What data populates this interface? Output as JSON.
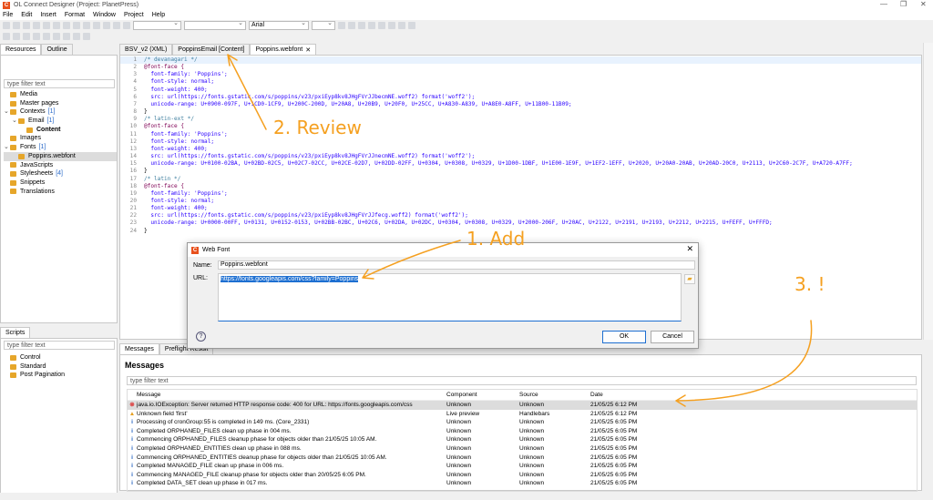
{
  "window": {
    "title": "OL Connect Designer (Project: PlanetPress)",
    "min": "—",
    "max": "❐",
    "close": "✕"
  },
  "menu": [
    "File",
    "Edit",
    "Insert",
    "Format",
    "Window",
    "Project",
    "Help"
  ],
  "toolbar": {
    "font_combo": "Arial"
  },
  "left_panel": {
    "tabs": [
      "Resources",
      "Outline"
    ],
    "filter_placeholder": "type filter text",
    "tree": [
      {
        "label": "Media",
        "level": 0
      },
      {
        "label": "Master pages",
        "level": 0
      },
      {
        "label": "Contexts",
        "count": "[1]",
        "level": 0,
        "expanded": true
      },
      {
        "label": "Email",
        "count": "[1]",
        "level": 1,
        "expanded": true
      },
      {
        "label": "Content",
        "level": 2,
        "bold": true
      },
      {
        "label": "Images",
        "level": 0
      },
      {
        "label": "Fonts",
        "count": "[1]",
        "level": 0,
        "expanded": true
      },
      {
        "label": "Poppins.webfont",
        "level": 1,
        "selected": true
      },
      {
        "label": "JavaScripts",
        "level": 0
      },
      {
        "label": "Stylesheets",
        "count": "[4]",
        "level": 0
      },
      {
        "label": "Snippets",
        "level": 0
      },
      {
        "label": "Translations",
        "level": 0
      }
    ]
  },
  "scripts_panel": {
    "tab": "Scripts",
    "filter_placeholder": "type filter text",
    "items": [
      "Control",
      "Standard",
      "Post Pagination"
    ]
  },
  "editor": {
    "tabs": [
      "BSV_v2 (XML)",
      "PoppinsEmail [Content]",
      "Poppins.webfont"
    ],
    "active_tab": 2,
    "lines": [
      "/* devanagari */",
      "@font-face {",
      "  font-family: 'Poppins';",
      "  font-style: normal;",
      "  font-weight: 400;",
      "  src: url(https://fonts.gstatic.com/s/poppins/v23/pxiEyp8kv8JHgFVrJJbecmNE.woff2) format('woff2');",
      "  unicode-range: U+0900-097F, U+1CD0-1CF9, U+200C-200D, U+20A8, U+20B9, U+20F0, U+25CC, U+A830-A839, U+A8E0-A8FF, U+11B00-11B09;",
      "}",
      "/* latin-ext */",
      "@font-face {",
      "  font-family: 'Poppins';",
      "  font-style: normal;",
      "  font-weight: 400;",
      "  src: url(https://fonts.gstatic.com/s/poppins/v23/pxiEyp8kv8JHgFVrJJnecmNE.woff2) format('woff2');",
      "  unicode-range: U+0100-02BA, U+02BD-02C5, U+02C7-02CC, U+02CE-02D7, U+02DD-02FF, U+0304, U+0308, U+0329, U+1D00-1DBF, U+1E00-1E9F, U+1EF2-1EFF, U+2020, U+20A0-20AB, U+20AD-20C0, U+2113, U+2C60-2C7F, U+A720-A7FF;",
      "}",
      "/* latin */",
      "@font-face {",
      "  font-family: 'Poppins';",
      "  font-style: normal;",
      "  font-weight: 400;",
      "  src: url(https://fonts.gstatic.com/s/poppins/v23/pxiEyp8kv8JHgFVrJJfecg.woff2) format('woff2');",
      "  unicode-range: U+0000-00FF, U+0131, U+0152-0153, U+02BB-02BC, U+02C6, U+02DA, U+02DC, U+0304, U+0308, U+0329, U+2000-206F, U+20AC, U+2122, U+2191, U+2193, U+2212, U+2215, U+FEFF, U+FFFD;",
      "}"
    ]
  },
  "dialog": {
    "title": "Web Font",
    "name_label": "Name:",
    "name_value": "Poppins.webfont",
    "url_label": "URL:",
    "url_value": "https://fonts.googleapis.com/css?family=Poppins",
    "ok": "OK",
    "cancel": "Cancel",
    "help": "?"
  },
  "messages": {
    "tabs": [
      "Messages",
      "Preflight Result"
    ],
    "title": "Messages",
    "filter_placeholder": "type filter text",
    "columns": [
      "Message",
      "Component",
      "Source",
      "Date"
    ],
    "rows": [
      {
        "type": "error",
        "message": "java.io.IOException: Server returned HTTP response code: 400 for URL: https://fonts.googleapis.com/css",
        "component": "Unknown",
        "source": "Unknown",
        "date": "21/05/25 6:12 PM"
      },
      {
        "type": "warning",
        "message": "Unknown field 'first'",
        "component": "Live preview",
        "source": "Handlebars",
        "date": "21/05/25 6:12 PM"
      },
      {
        "type": "info",
        "message": "Processing of cronGroup:55 is completed in 149 ms. (Core_2331)",
        "component": "Unknown",
        "source": "Unknown",
        "date": "21/05/25 6:05 PM"
      },
      {
        "type": "info",
        "message": "Completed ORPHANED_FILES clean up phase in 004 ms.",
        "component": "Unknown",
        "source": "Unknown",
        "date": "21/05/25 6:05 PM"
      },
      {
        "type": "info",
        "message": "Commencing ORPHANED_FILES cleanup phase for objects older than 21/05/25 10:05 AM.",
        "component": "Unknown",
        "source": "Unknown",
        "date": "21/05/25 6:05 PM"
      },
      {
        "type": "info",
        "message": "Completed ORPHANED_ENTITIES clean up phase in 088 ms.",
        "component": "Unknown",
        "source": "Unknown",
        "date": "21/05/25 6:05 PM"
      },
      {
        "type": "info",
        "message": "Commencing ORPHANED_ENTITIES cleanup phase for objects older than 21/05/25 10:05 AM.",
        "component": "Unknown",
        "source": "Unknown",
        "date": "21/05/25 6:05 PM"
      },
      {
        "type": "info",
        "message": "Completed MANAGED_FILE clean up phase in 006 ms.",
        "component": "Unknown",
        "source": "Unknown",
        "date": "21/05/25 6:05 PM"
      },
      {
        "type": "info",
        "message": "Commencing MANAGED_FILE cleanup phase for objects older than 20/05/25 6:05 PM.",
        "component": "Unknown",
        "source": "Unknown",
        "date": "21/05/25 6:05 PM"
      },
      {
        "type": "info",
        "message": "Completed DATA_SET clean up phase in 017 ms.",
        "component": "Unknown",
        "source": "Unknown",
        "date": "21/05/25 6:05 PM"
      }
    ]
  },
  "annotations": {
    "step1": "1. Add",
    "step2": "2. Review",
    "step3": "3. !",
    "color": "#f5a020"
  }
}
